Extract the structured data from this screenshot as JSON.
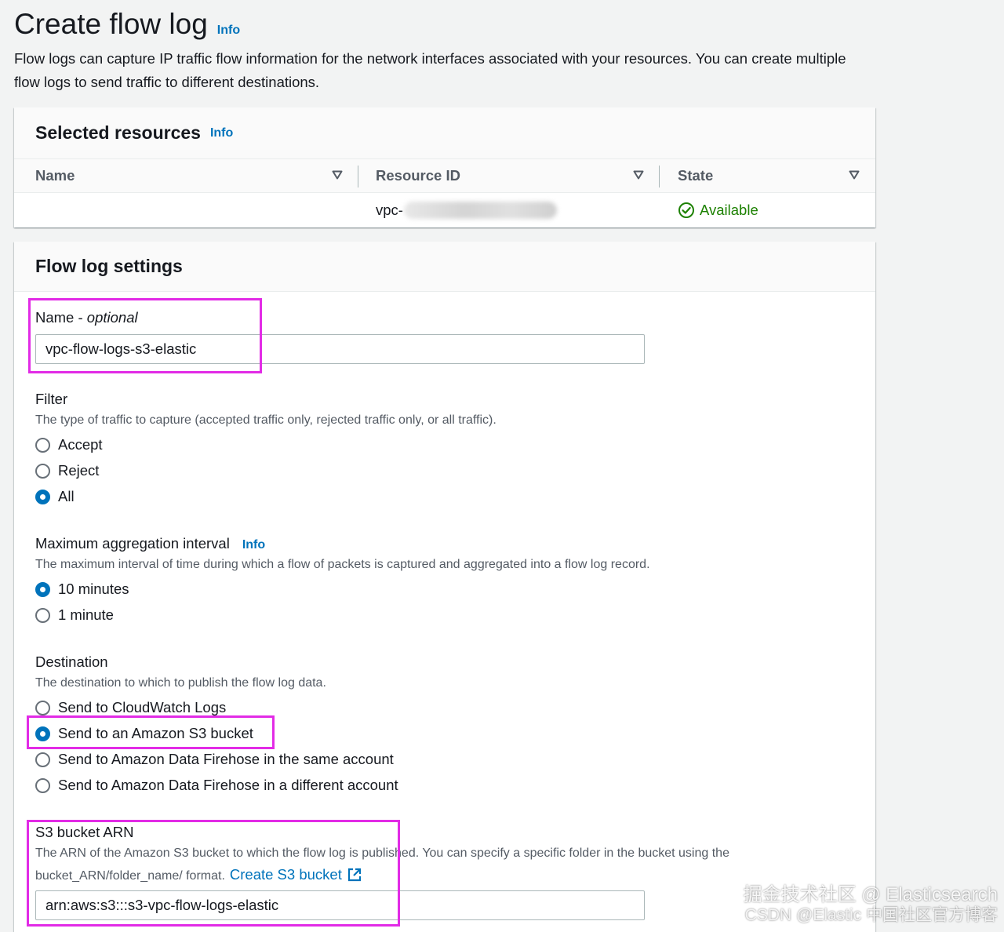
{
  "page": {
    "title": "Create flow log",
    "info_label": "Info",
    "description": "Flow logs can capture IP traffic flow information for the network interfaces associated with your resources. You can create multiple flow logs to send traffic to different destinations."
  },
  "selected_resources": {
    "title": "Selected resources",
    "info_label": "Info",
    "columns": [
      "Name",
      "Resource ID",
      "State"
    ],
    "rows": [
      {
        "name": "",
        "resource_id": "vpc-",
        "state": "Available"
      }
    ]
  },
  "settings": {
    "title": "Flow log settings",
    "name": {
      "label": "Name - ",
      "label_suffix": "optional",
      "value": "vpc-flow-logs-s3-elastic"
    },
    "filter": {
      "label": "Filter",
      "description": "The type of traffic to capture (accepted traffic only, rejected traffic only, or all traffic).",
      "options": [
        "Accept",
        "Reject",
        "All"
      ],
      "selected": "All"
    },
    "interval": {
      "label": "Maximum aggregation interval",
      "info_label": "Info",
      "description": "The maximum interval of time during which a flow of packets is captured and aggregated into a flow log record.",
      "options": [
        "10 minutes",
        "1 minute"
      ],
      "selected": "10 minutes"
    },
    "destination": {
      "label": "Destination",
      "description": "The destination to which to publish the flow log data.",
      "options": [
        "Send to CloudWatch Logs",
        "Send to an Amazon S3 bucket",
        "Send to Amazon Data Firehose in the same account",
        "Send to Amazon Data Firehose in a different account"
      ],
      "selected": "Send to an Amazon S3 bucket"
    },
    "s3_arn": {
      "label": "S3 bucket ARN",
      "description_line1": "The ARN of the Amazon S3 bucket to which the flow log is published. You can specify a specific folder in the bucket using the",
      "description_line2": "bucket_ARN/folder_name/ format.",
      "create_link": "Create S3 bucket",
      "value": "arn:aws:s3:::s3-vpc-flow-logs-elastic"
    }
  },
  "watermark": {
    "line1": "掘金技术社区 @ Elasticsearch",
    "line2": "CSDN @Elastic 中国社区官方博客"
  },
  "colors": {
    "accent": "#0073bb",
    "success": "#1d8102",
    "highlight": "#e22be6"
  }
}
